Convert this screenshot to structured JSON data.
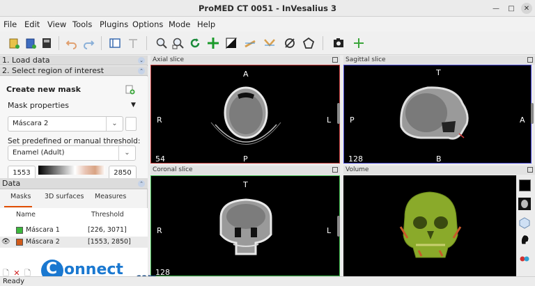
{
  "window": {
    "title": "ProMED CT 0051 - InVesalius 3"
  },
  "menu": [
    "File",
    "Edit",
    "View",
    "Tools",
    "Plugins",
    "Options",
    "Mode",
    "Help"
  ],
  "left": {
    "load_data": "1. Load data",
    "select_roi": "2. Select region of interest",
    "create_mask": "Create new mask",
    "mask_properties": "Mask properties",
    "mask_select": "Máscara 2",
    "threshold_label": "Set predefined or manual threshold:",
    "threshold_select": "Enamel (Adult)",
    "threshold_min": "1553",
    "threshold_max": "2850"
  },
  "data": {
    "title": "Data",
    "tabs": [
      "Masks",
      "3D surfaces",
      "Measures"
    ],
    "columns": [
      "Name",
      "Threshold"
    ],
    "rows": [
      {
        "name": "Máscara 1",
        "threshold": "[226, 3071]",
        "color": "#3cb83c"
      },
      {
        "name": "Máscara 2",
        "threshold": "[1553, 2850]",
        "color": "#d05a1a"
      }
    ]
  },
  "views": {
    "axial": {
      "title": "Axial slice",
      "top": "A",
      "left": "R",
      "right": "L",
      "bottom": "P",
      "slice": "54"
    },
    "sagittal": {
      "title": "Sagittal slice",
      "top": "T",
      "left": "P",
      "right": "A",
      "bottom": "B",
      "slice": "128"
    },
    "coronal": {
      "title": "Coronal slice",
      "top": "T",
      "left": "R",
      "right": "L",
      "slice": "128"
    },
    "volume": {
      "title": "Volume"
    }
  },
  "status": "Ready",
  "watermark": {
    "text": "onnect",
    "domain": ".com",
    "letter": "C"
  },
  "colors": {
    "axial_border": "#c83c3c",
    "sagittal_border": "#4a4ad6",
    "coronal_border": "#3cb84a",
    "accent": "#e04e00",
    "logo": "#1a78d0"
  },
  "icons": [
    "open-icon",
    "import-icon",
    "save-icon",
    "undo-icon",
    "redo-icon",
    "layout-icon",
    "text-icon",
    "zoom-icon",
    "zoom-select-icon",
    "rotate-icon",
    "pan-icon",
    "contrast-icon",
    "measure-icon",
    "angle-icon",
    "draw-icon",
    "polygon-icon",
    "screenshot-icon",
    "add-icon"
  ]
}
